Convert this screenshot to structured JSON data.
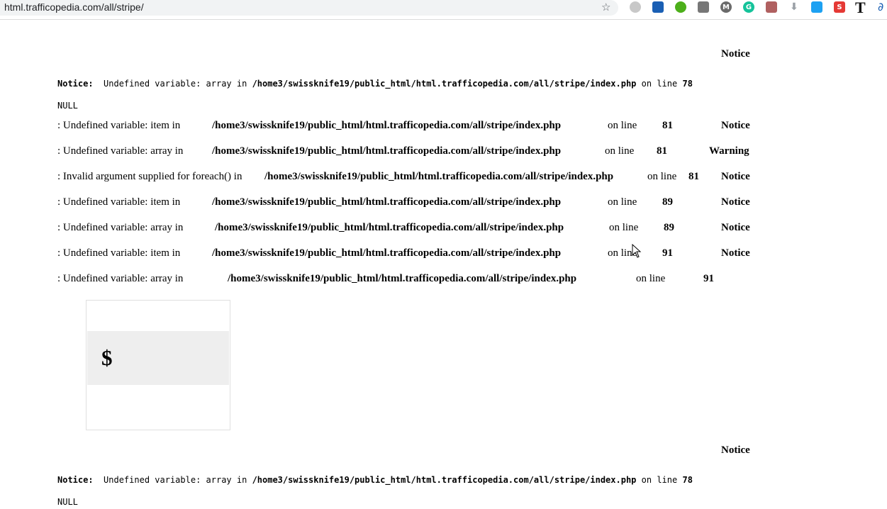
{
  "browser": {
    "url": "html.trafficopedia.com/all/stripe/",
    "extensions": [
      {
        "name": "circle-icon",
        "color": "#c8c8c8"
      },
      {
        "name": "person-icon",
        "color": "#1a5fb4"
      },
      {
        "name": "leaf-icon",
        "color": "#4caf1a"
      },
      {
        "name": "camera-icon",
        "color": "#777777"
      },
      {
        "name": "m-icon",
        "color": "#6b6b6b"
      },
      {
        "name": "grammarly-icon",
        "color": "#15c39a"
      },
      {
        "name": "pdf-icon",
        "color": "#b06060"
      },
      {
        "name": "download-icon",
        "color": "#9aa0a6"
      },
      {
        "name": "twitter-icon",
        "color": "#1da1f2"
      },
      {
        "name": "s-icon",
        "color": "#e53935"
      }
    ],
    "t_extension": "T"
  },
  "page": {
    "notice_heading_1": "Notice",
    "notice_line_1": {
      "label": "Notice:",
      "message": "Undefined variable: array in",
      "path": "/home3/swissknife19/public_html/html.trafficopedia.com/all/stripe/index.php",
      "on_line": "on line",
      "line": "78"
    },
    "null_1": "NULL",
    "rows": [
      {
        "msg": ": Undefined variable: item in",
        "path": "/home3/swissknife19/public_html/html.trafficopedia.com/all/stripe/index.php",
        "on_line": "on line",
        "line": "81",
        "level": "Notice"
      },
      {
        "msg": ": Undefined variable: array in",
        "path": "/home3/swissknife19/public_html/html.trafficopedia.com/all/stripe/index.php",
        "on_line": "on line",
        "line": "81",
        "level": "Warning"
      },
      {
        "msg": ": Invalid argument supplied for foreach() in",
        "path": "/home3/swissknife19/public_html/html.trafficopedia.com/all/stripe/index.php",
        "on_line": "on line",
        "line": "81",
        "level": "Notice"
      },
      {
        "msg": ": Undefined variable: item in",
        "path": "/home3/swissknife19/public_html/html.trafficopedia.com/all/stripe/index.php",
        "on_line": "on line",
        "line": "89",
        "level": "Notice"
      },
      {
        "msg": ": Undefined variable: array in",
        "path": "/home3/swissknife19/public_html/html.trafficopedia.com/all/stripe/index.php",
        "on_line": "on line",
        "line": "89",
        "level": "Notice"
      },
      {
        "msg": ": Undefined variable: item in",
        "path": "/home3/swissknife19/public_html/html.trafficopedia.com/all/stripe/index.php",
        "on_line": "on line",
        "line": "91",
        "level": "Notice"
      },
      {
        "msg": ": Undefined variable: array in",
        "path": "/home3/swissknife19/public_html/html.trafficopedia.com/all/stripe/index.php",
        "on_line": "on line",
        "line": "91",
        "level": ""
      }
    ],
    "price_symbol": "$",
    "notice_heading_2": "Notice",
    "notice_line_2": {
      "label": "Notice:",
      "message": "Undefined variable: array in",
      "path": "/home3/swissknife19/public_html/html.trafficopedia.com/all/stripe/index.php",
      "on_line": "on line",
      "line": "78"
    },
    "null_2": "NULL"
  }
}
